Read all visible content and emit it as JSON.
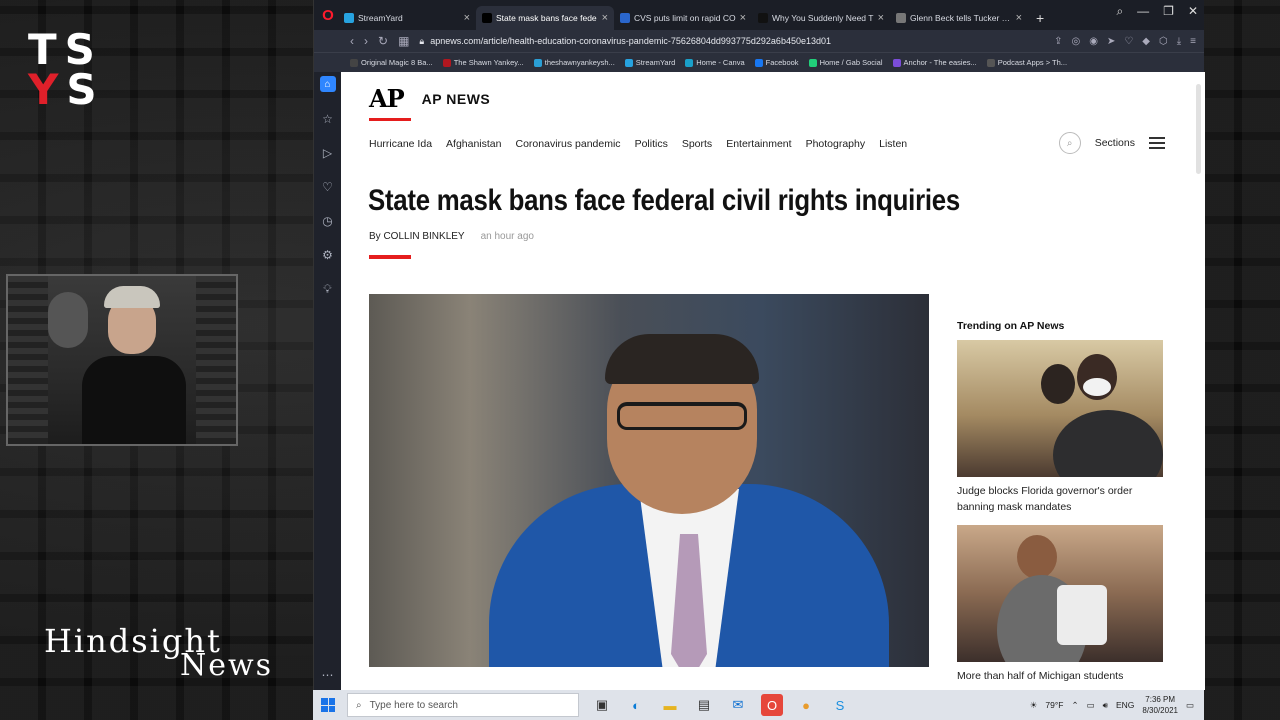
{
  "overlay": {
    "logo_top": [
      "T",
      "S"
    ],
    "logo_bottom": [
      "Y",
      "S"
    ],
    "show_title_1": "Hindsight",
    "show_title_2": "News"
  },
  "browser": {
    "tabs": [
      {
        "title": "StreamYard",
        "color": "#27a3e0",
        "active": false
      },
      {
        "title": "State mask bans face fede",
        "color": "#000000",
        "active": true
      },
      {
        "title": "CVS puts limit on rapid CO",
        "color": "#2a66cc",
        "active": false
      },
      {
        "title": "Why You Suddenly Need T",
        "color": "#111111",
        "active": false
      },
      {
        "title": "Glenn Beck tells Tucker Ca",
        "color": "#777777",
        "active": false
      }
    ],
    "new_tab": "+",
    "url": "apnews.com/article/health-education-coronavirus-pandemic-75626804dd993775d292a6b450e13d01",
    "bookmarks": [
      {
        "label": "Original Magic 8 Ba...",
        "color": "#444444"
      },
      {
        "label": "The Shawn Yankey...",
        "color": "#b0171f"
      },
      {
        "label": "theshawnyankeysh...",
        "color": "#2a9fd6"
      },
      {
        "label": "StreamYard",
        "color": "#27a3e0"
      },
      {
        "label": "Home - Canva",
        "color": "#1aa0c9"
      },
      {
        "label": "Facebook",
        "color": "#1877f2"
      },
      {
        "label": "Home / Gab Social",
        "color": "#21cf7a"
      },
      {
        "label": "Anchor - The easies...",
        "color": "#7b4dd9"
      },
      {
        "label": "Podcast Apps > Th...",
        "color": "#555555"
      }
    ]
  },
  "site": {
    "logo": "AP",
    "brand": "AP NEWS",
    "nav": [
      "Hurricane Ida",
      "Afghanistan",
      "Coronavirus pandemic",
      "Politics",
      "Sports",
      "Entertainment",
      "Photography",
      "Listen"
    ],
    "sections_label": "Sections"
  },
  "article": {
    "headline": "State mask bans face federal civil rights inquiries",
    "byline": "By COLLIN BINKLEY",
    "time": "an hour ago"
  },
  "trending": {
    "heading": "Trending on AP News",
    "items": [
      {
        "caption": "Judge blocks Florida governor's order banning mask mandates"
      },
      {
        "caption": "More than half of Michigan students"
      }
    ]
  },
  "taskbar": {
    "search_placeholder": "Type here to search",
    "weather": "79°F",
    "lang": "ENG",
    "time": "7:36 PM",
    "date": "8/30/2021"
  }
}
